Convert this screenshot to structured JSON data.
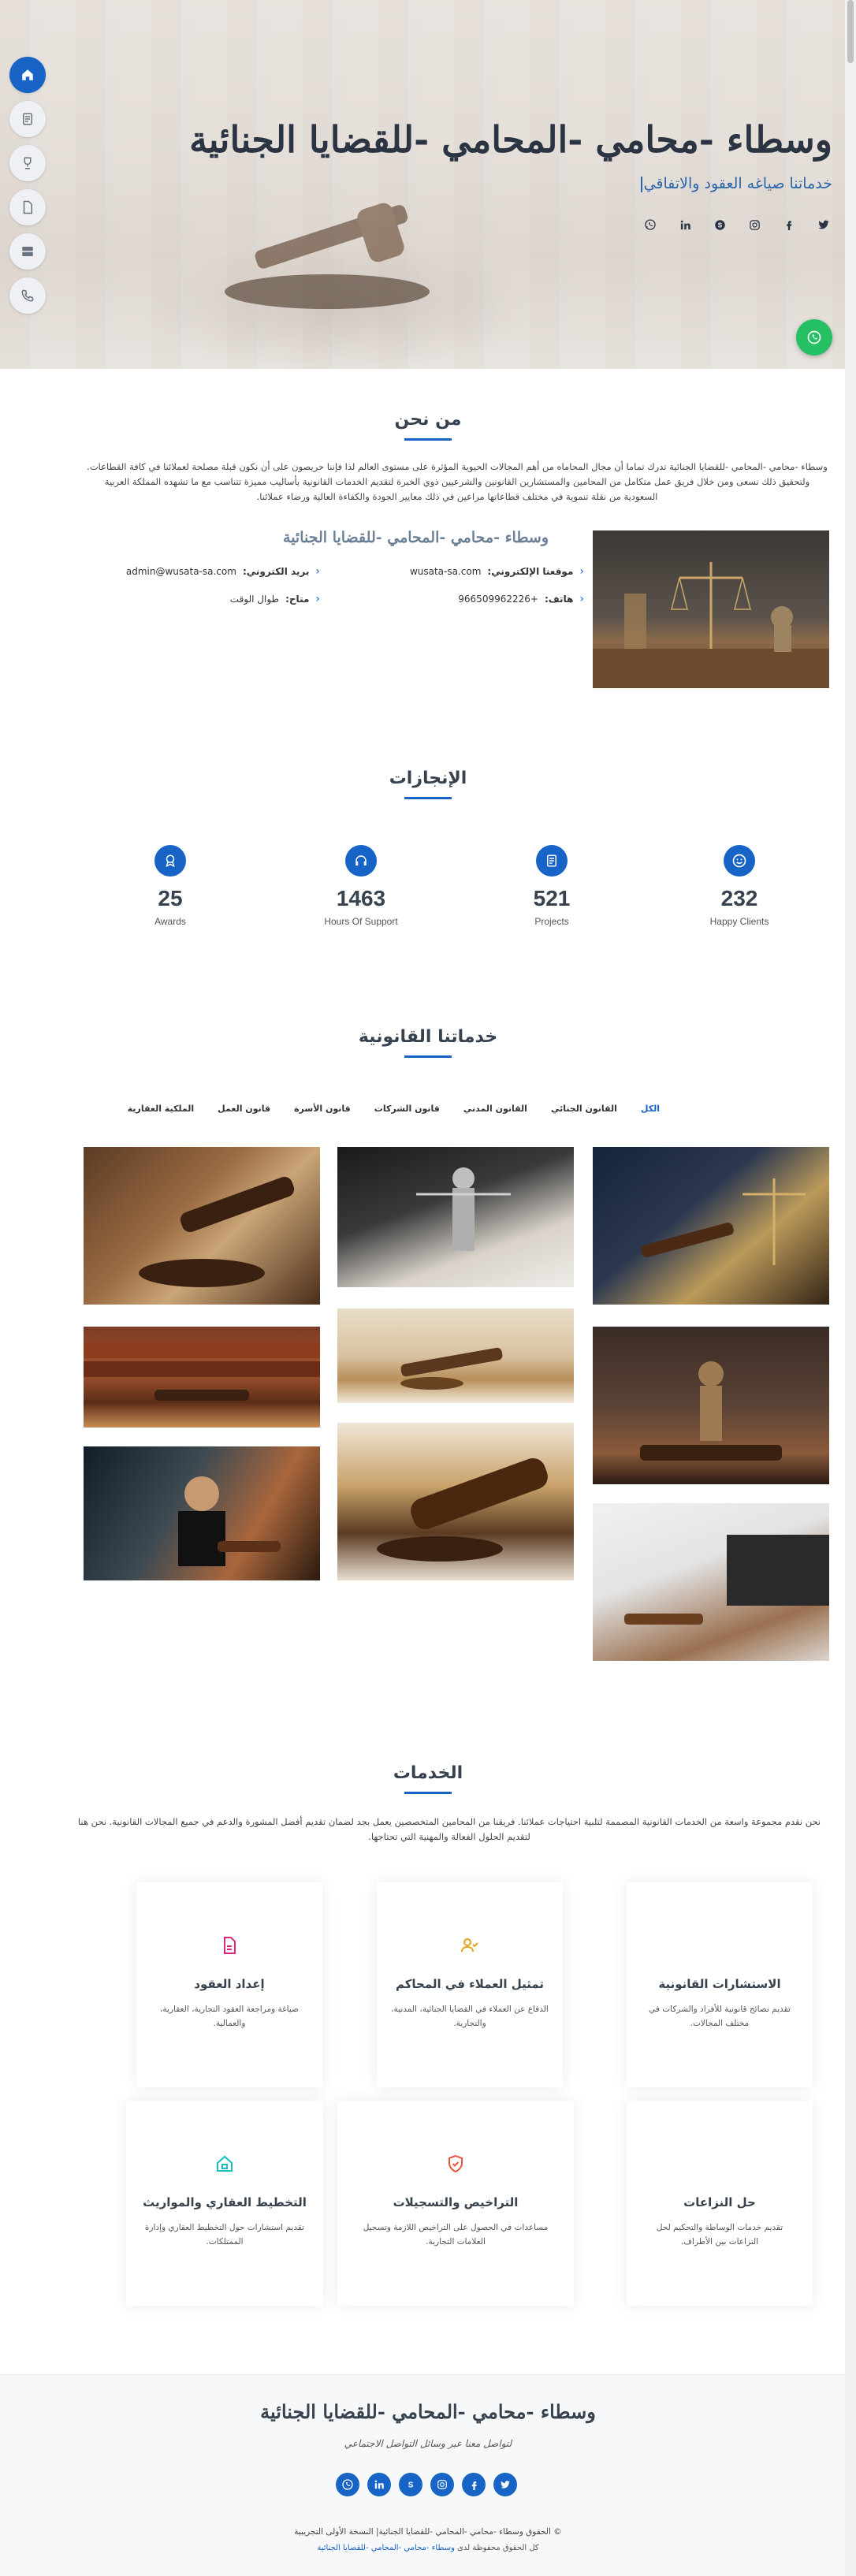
{
  "hero": {
    "title": "وسطاء -محامي -المحامي -للقضايا الجنائية",
    "typed_text": "خدماتنا صياغه العقود والاتفاقي",
    "social_icons": [
      "twitter-icon",
      "facebook-icon",
      "instagram-icon",
      "skype-icon",
      "linkedin-icon",
      "whatsapp-icon"
    ]
  },
  "sidenav": {
    "items": [
      {
        "name": "home",
        "icon": "home-icon",
        "active": true
      },
      {
        "name": "about",
        "icon": "document-icon",
        "active": false
      },
      {
        "name": "achievements",
        "icon": "trophy-icon",
        "active": false
      },
      {
        "name": "portfolio",
        "icon": "file-icon",
        "active": false
      },
      {
        "name": "services",
        "icon": "server-icon",
        "active": false
      },
      {
        "name": "contact",
        "icon": "phone-icon",
        "active": false
      }
    ]
  },
  "about": {
    "heading": "من نحن",
    "text": "وسطاء -محامي -المحامي -للقضايا الجنائية تدرك تماما أن مجال المحاماه من أهم المجالات الحيوية المؤثرة على مستوى العالم لذا فإننا حريصون على أن نكون قبلة مصلحة لعملائنا في كافة القطاعات. ولتحقيق ذلك نسعى ومن خلال فريق عمل متكامل من المحامين والمستشارين القانونين والشرعيين ذوي الخبرة لتقديم الخدمات القانونية بأساليب مميزة تتناسب مع ما تشهده المملكة العربية السعودية من نقلة تنموية في مختلف قطاعاتها مراعين في ذلك معايير الجودة والكفاءة العالية ورضاء عملائنا.",
    "subheading": "وسطاء -محامي -المحامي -للقضايا الجنائية",
    "info": [
      {
        "label": "موقعنا الإلكتروني:",
        "value": "wusata-sa.com"
      },
      {
        "label": "بريد الكتروني:",
        "value": "admin@wusata-sa.com"
      },
      {
        "label": "هاتف:",
        "value": "+966509962226"
      },
      {
        "label": "متاح:",
        "value": "طوال الوقت"
      }
    ]
  },
  "achievements": {
    "heading": "الإنجازات",
    "stats": [
      {
        "value": "232",
        "label": "Happy Clients",
        "icon": "smile-icon"
      },
      {
        "value": "521",
        "label": "Projects",
        "icon": "journal-icon"
      },
      {
        "value": "1463",
        "label": "Hours Of Support",
        "icon": "headset-icon"
      },
      {
        "value": "25",
        "label": "Awards",
        "icon": "award-icon"
      }
    ]
  },
  "portfolio": {
    "heading": "خدماتنا القانونية",
    "filters": [
      "الكل",
      "القانون الجنائي",
      "القانون المدني",
      "قانون الشركات",
      "قانون الأسرة",
      "قانون العمل",
      "الملكية العقارية"
    ]
  },
  "services": {
    "heading": "الخدمات",
    "intro": "نحن نقدم مجموعة واسعة من الخدمات القانونية المصممة لتلبية احتياجات عملائنا. فريقنا من المحامين المتخصصين يعمل بجد لضمان تقديم أفضل المشورة والدعم في جميع المجالات القانونية. نحن هنا لتقديم الحلول الفعالة والمهنية التي تحتاجها.",
    "cards": [
      {
        "title": "الاستشارات القانونية",
        "desc": "تقديم نصائح قانونية للأفراد والشركات في مختلف المجالات.",
        "icon": "shield-check-icon",
        "color": "#ffffff"
      },
      {
        "title": "تمثيل العملاء في المحاكم",
        "desc": "الدفاع عن العملاء في القضايا الجنائية، المدنية، والتجارية.",
        "icon": "user-check-icon",
        "color": "#e4a11b"
      },
      {
        "title": "إعداد العقود",
        "desc": "صياغة ومراجعة العقود التجارية، العقارية، والعمالية.",
        "icon": "file-text-icon",
        "color": "#e0267f"
      },
      {
        "title": "حل النزاعات",
        "desc": "تقديم خدمات الوساطة والتحكيم لحل النزاعات بين الأطراف.",
        "icon": "scales-icon",
        "color": "#ffffff"
      },
      {
        "title": "التراخيص والتسجيلات",
        "desc": "مساعدات في الحصول على التراخيص اللازمة وتسجيل العلامات التجارية.",
        "icon": "shield-check-icon",
        "color": "#e8553b"
      },
      {
        "title": "التخطيط العقاري والمواريث",
        "desc": "تقديم استشارات حول التخطيط العقاري وإدارة الممتلكات.",
        "icon": "house-icon",
        "color": "#15bfbf"
      }
    ]
  },
  "footer": {
    "title": "وسطاء -محامي -المحامي -للقضايا الجنائية",
    "subtitle": "لتواصل معنا عبر وسائل التواصل الاجتماعي",
    "copyright": "© الحقوق وسطاء -محامي -المحامي -للقضايا الجنائية| النسخة الأولى التجريبية",
    "credit_prefix": "كل الحقوق محفوظة لدى",
    "credit_link": "وسطاء -محامي -المحامي -للقضايا الجنائية",
    "social_icons": [
      "twitter-icon",
      "facebook-icon",
      "instagram-icon",
      "skype-icon",
      "linkedin-icon",
      "whatsapp-icon"
    ]
  }
}
